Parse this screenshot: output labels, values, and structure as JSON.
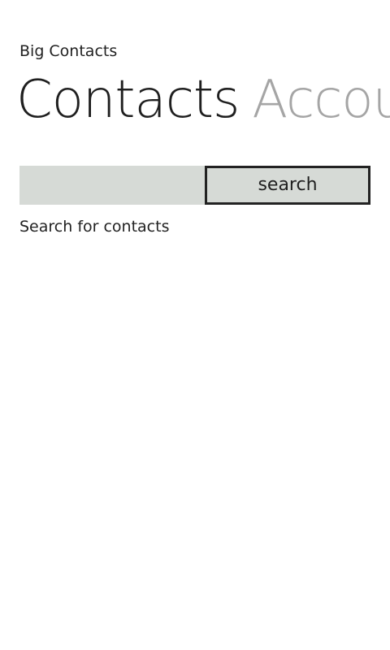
{
  "app": {
    "title": "Big Contacts"
  },
  "pivot": {
    "items": [
      {
        "label": "Contacts",
        "active": true
      },
      {
        "label": "Accou",
        "active": false
      }
    ]
  },
  "search": {
    "input_value": "",
    "button_label": "search",
    "hint": "Search for contacts"
  },
  "colors": {
    "background": "#ffffff",
    "text": "#222222",
    "inactive_header": "#a5a5a5",
    "input_fill": "#d6dad6",
    "button_border": "#222222"
  }
}
